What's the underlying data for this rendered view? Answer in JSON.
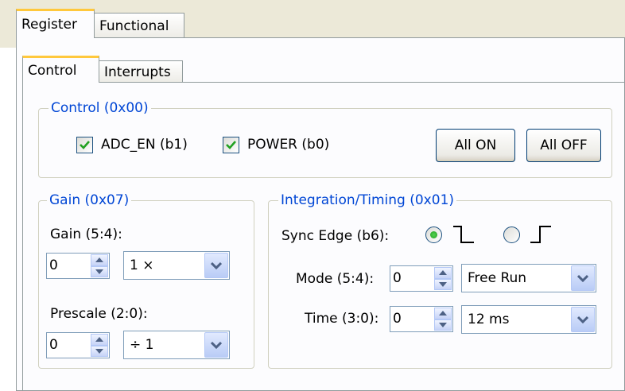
{
  "tabs": {
    "register": "Register",
    "functional": "Functional"
  },
  "subtabs": {
    "control": "Control",
    "interrupts": "Interrupts"
  },
  "control_group": {
    "title": "Control (0x00)",
    "adc_en_label": "ADC_EN (b1)",
    "power_label": "POWER (b0)",
    "all_on": "All ON",
    "all_off": "All OFF"
  },
  "gain_group": {
    "title": "Gain (0x07)",
    "gain_label": "Gain (5:4):",
    "gain_value": "0",
    "gain_select": "1 ×",
    "prescale_label": "Prescale (2:0):",
    "prescale_value": "0",
    "prescale_select": "÷ 1"
  },
  "timing_group": {
    "title": "Integration/Timing (0x01)",
    "sync_label": "Sync Edge (b6):",
    "mode_label": "Mode (5:4):",
    "mode_value": "0",
    "mode_select": "Free Run",
    "time_label": "Time (3:0):",
    "time_value": "0",
    "time_select": "12 ms"
  },
  "colors": {
    "accent_tab": "#ffc83c",
    "legend_text": "#0046d5",
    "check_green": "#21a121"
  }
}
